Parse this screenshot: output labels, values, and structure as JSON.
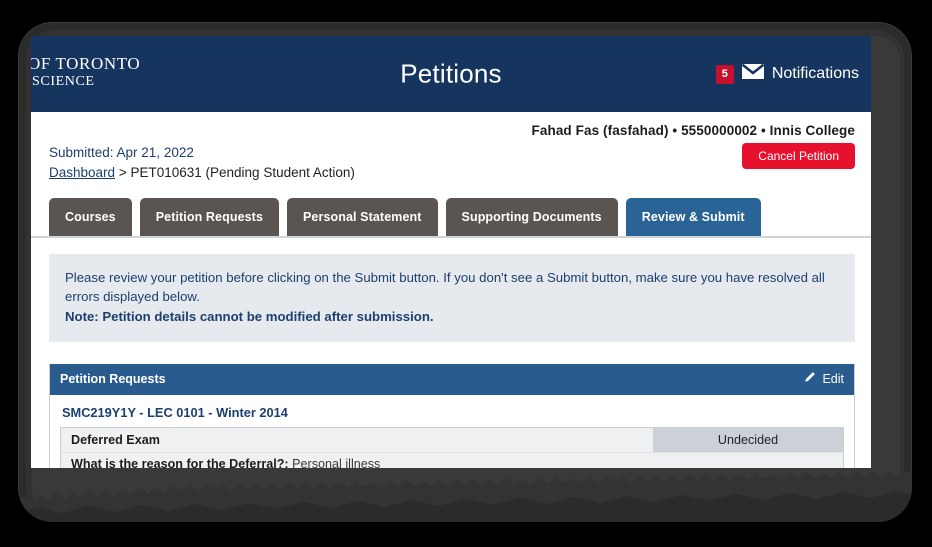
{
  "header": {
    "logo_line1": "OF TORONTO",
    "logo_line2": "SCIENCE",
    "title": "Petitions",
    "notifications": {
      "count": "5",
      "label": "Notifications",
      "icon": "envelope-icon"
    },
    "colors": {
      "navy": "#16355e",
      "badge_red": "#c8102e"
    }
  },
  "user": {
    "identity": "Fahad Fas (fasfahad) • 5550000002 • Innis College"
  },
  "meta": {
    "submitted": "Submitted: Apr 21, 2022",
    "breadcrumb_link": "Dashboard",
    "breadcrumb_separator": ">",
    "breadcrumb_current": "PET010631 (Pending Student Action)",
    "cancel_button": "Cancel Petition",
    "cancel_color": "#e8112d"
  },
  "tabs": [
    {
      "label": "Courses",
      "active": false
    },
    {
      "label": "Petition Requests",
      "active": false
    },
    {
      "label": "Personal Statement",
      "active": false
    },
    {
      "label": "Supporting Documents",
      "active": false
    },
    {
      "label": "Review & Submit",
      "active": true
    }
  ],
  "info": {
    "paragraph": "Please review your petition before clicking on the Submit button. If you don't see a Submit button, make sure you have resolved all errors displayed below.",
    "note": "Note: Petition details cannot be modified after submission."
  },
  "section": {
    "heading": "Petition Requests",
    "edit_label": "Edit",
    "edit_icon": "pencil-icon",
    "course": "SMC219Y1Y - LEC 0101 - Winter 2014",
    "request_name": "Deferred Exam",
    "request_status": "Undecided",
    "question": "What is the reason for the Deferral?:",
    "answer": "Personal illness"
  }
}
